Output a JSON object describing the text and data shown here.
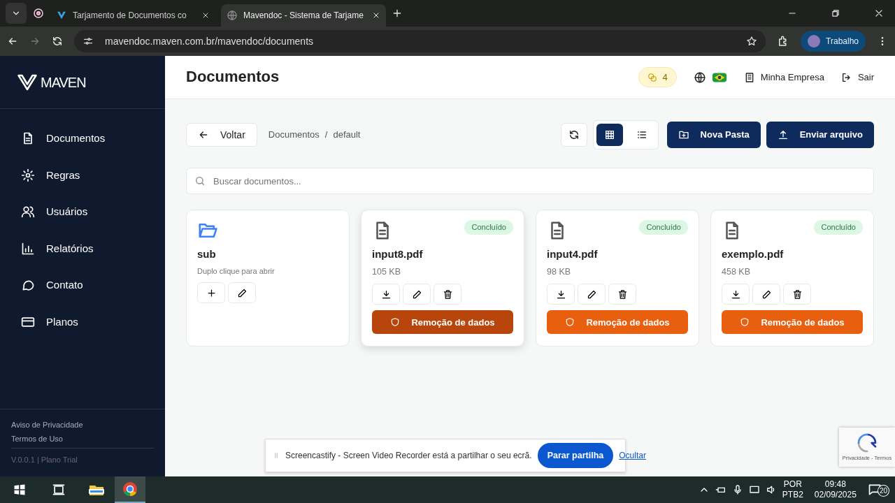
{
  "browser": {
    "tabs": [
      {
        "title": "Tarjamento de Documentos co",
        "kind": "logo",
        "selected": false
      },
      {
        "title": "Mavendoc - Sistema de Tarjame",
        "kind": "globe",
        "selected": true
      }
    ],
    "url": "mavendoc.maven.com.br/mavendoc/documents",
    "profile": "Trabalho"
  },
  "sidebar": {
    "logo": "MAVEN",
    "items": [
      {
        "label": "Documentos"
      },
      {
        "label": "Regras"
      },
      {
        "label": "Usuários"
      },
      {
        "label": "Relatórios"
      },
      {
        "label": "Contato"
      },
      {
        "label": "Planos"
      }
    ],
    "links": [
      "Aviso de Privacidade",
      "Termos de Uso"
    ],
    "version": "V.0.0.1 | Plano Trial"
  },
  "header": {
    "title": "Documentos",
    "credits": "4",
    "company": "Minha Empresa",
    "logout": "Sair"
  },
  "toolbar": {
    "back": "Voltar",
    "breadcrumb": [
      "Documentos",
      "default"
    ],
    "breadcrumb_separator": "/",
    "views": [
      {
        "kind": "grid",
        "selected": true
      },
      {
        "kind": "list",
        "selected": false
      }
    ],
    "new_folder": "Nova Pasta",
    "upload": "Enviar arquivo"
  },
  "search": {
    "placeholder": "Buscar documentos..."
  },
  "items": [
    {
      "kind": "folder",
      "name": "sub",
      "hint": "Duplo clique para abrir"
    },
    {
      "kind": "file",
      "name": "input8.pdf",
      "size": "105 KB",
      "status": "Concluído",
      "action": "Remoção de dados",
      "hovered": true
    },
    {
      "kind": "file",
      "name": "input4.pdf",
      "size": "98 KB",
      "status": "Concluído",
      "action": "Remoção de dados",
      "hovered": false
    },
    {
      "kind": "file",
      "name": "exemplo.pdf",
      "size": "458 KB",
      "status": "Concluído",
      "action": "Remoção de dados",
      "hovered": false
    }
  ],
  "share_bar": {
    "text": "Screencastify - Screen Video Recorder está a partilhar o seu ecrã.",
    "button": "Parar partilha",
    "link": "Ocultar"
  },
  "recaptcha": {
    "text": "Privacidade - Termos"
  },
  "taskbar": {
    "lang": "POR",
    "layout": "PTB2",
    "time": "09:48",
    "date": "02/09/2025",
    "notifications": "20"
  }
}
